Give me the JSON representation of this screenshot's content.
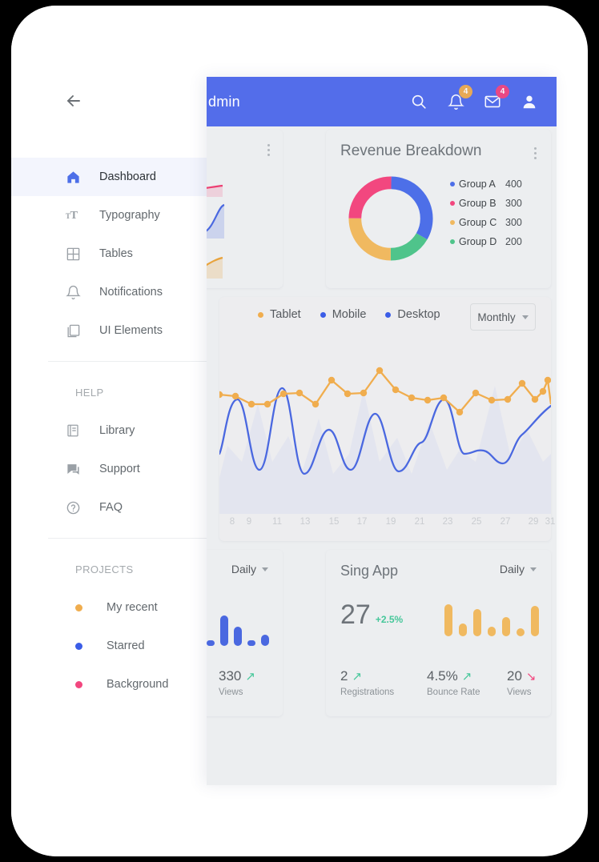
{
  "header": {
    "title": "dmin",
    "search_icon": "search-icon",
    "bell_badge": "4",
    "bell_badge_color": "#f0ad4e",
    "mail_badge": "4",
    "mail_badge_color": "#f2477f",
    "brand_color": "#536dea"
  },
  "sidebar": {
    "back_label": "back-arrow",
    "nav": [
      {
        "label": "Dashboard",
        "icon": "home-icon",
        "active": true
      },
      {
        "label": "Typography",
        "icon": "typography-icon",
        "active": false
      },
      {
        "label": "Tables",
        "icon": "table-grid-icon",
        "active": false
      },
      {
        "label": "Notifications",
        "icon": "bell-icon",
        "active": false
      },
      {
        "label": "UI Elements",
        "icon": "layers-icon",
        "active": false
      }
    ],
    "help_heading": "HELP",
    "help": [
      {
        "label": "Library",
        "icon": "book-icon"
      },
      {
        "label": "Support",
        "icon": "chat-icon"
      },
      {
        "label": "FAQ",
        "icon": "question-circle-icon"
      }
    ],
    "projects_heading": "PROJECTS",
    "projects": [
      {
        "label": "My recent",
        "color": "#f0ad4e"
      },
      {
        "label": "Starred",
        "color": "#3b5de7"
      },
      {
        "label": "Background",
        "color": "#f2477f"
      }
    ]
  },
  "revenue_card": {
    "title": "Revenue Breakdown",
    "menu_icon": "more-vertical-icon"
  },
  "main_chart_card": {
    "legend": [
      {
        "label": "Tablet",
        "color": "#f0ad4e"
      },
      {
        "label": "Mobile",
        "color": "#3b5de7"
      },
      {
        "label": "Desktop",
        "color": "#3b5de7"
      }
    ],
    "period": "Monthly",
    "period_caret": "chevron-down-icon"
  },
  "left_stat_card": {
    "period": "Daily",
    "stat_value": "330",
    "stat_trend": "up",
    "stat_label": "Views",
    "bar_color": "#4a68e0"
  },
  "sing_app_card": {
    "title": "Sing App",
    "period": "Daily",
    "big_number": "27",
    "delta": "+2.5%",
    "bar_color": "#f0b960",
    "stats": [
      {
        "value": "2",
        "trend": "up",
        "label": "Registrations"
      },
      {
        "value": "4.5%",
        "trend": "up",
        "label": "Bounce Rate"
      },
      {
        "value": "20",
        "trend": "down",
        "label": "Views"
      }
    ]
  },
  "chart_data": [
    {
      "type": "pie",
      "title": "Revenue Breakdown",
      "labels": [
        "Group A",
        "Group B",
        "Group C",
        "Group D"
      ],
      "values": [
        400,
        300,
        300,
        200
      ],
      "colors": [
        "#4d6fe8",
        "#4fc48b",
        "#f0b960",
        "#f2477f"
      ],
      "legend_colors": [
        "#4d6fe8",
        "#f2477f",
        "#f0b960",
        "#4fc48b"
      ],
      "legend": "right",
      "donut": true
    },
    {
      "type": "line",
      "title": "",
      "xlabel": "",
      "ylabel": "",
      "grid": false,
      "legend": "top-left",
      "x": [
        8,
        9,
        11,
        13,
        15,
        17,
        19,
        21,
        23,
        25,
        27,
        29,
        31
      ],
      "tick_labels": [
        "8",
        "9",
        "11",
        "13",
        "15",
        "17",
        "19",
        "21",
        "23",
        "25",
        "27",
        "29",
        "31"
      ],
      "series": [
        {
          "name": "Tablet",
          "color": "#f0ad4e",
          "markers": true,
          "values": [
            68,
            58,
            58,
            67,
            67,
            62,
            74,
            60,
            58,
            78,
            66,
            62,
            62,
            61,
            54,
            64,
            61,
            61,
            70,
            60,
            64,
            67,
            80,
            57
          ]
        },
        {
          "name": "Mobile",
          "color": "#3b5de7",
          "markers": false,
          "values": [
            38,
            50,
            25,
            54,
            24,
            42,
            30,
            34,
            47,
            28,
            50,
            32,
            22,
            40,
            52,
            38,
            30,
            44,
            56
          ]
        },
        {
          "name": "Desktop",
          "color": "#dfe2ef",
          "area": true,
          "values": [
            20,
            44,
            22,
            46,
            20,
            30,
            26,
            52,
            24,
            32,
            56,
            30,
            48,
            26
          ]
        }
      ]
    },
    {
      "type": "bar",
      "title": "Left stat sparkbars",
      "color": "#4a68e0",
      "values": [
        8,
        40,
        26,
        8,
        16
      ]
    },
    {
      "type": "bar",
      "title": "Sing App sparkbars",
      "color": "#f0b960",
      "values": [
        42,
        18,
        36,
        14,
        26,
        12,
        40
      ]
    },
    {
      "type": "area",
      "title": "Sparkline card",
      "series": [
        {
          "name": "series-pink",
          "color": "#ec3f72",
          "values": [
            34,
            18,
            12,
            46,
            52,
            30,
            18,
            20,
            22
          ]
        },
        {
          "name": "series-blue",
          "color": "#4a68e0",
          "values": [
            18,
            40,
            50,
            20,
            14,
            38,
            20,
            14,
            44
          ]
        },
        {
          "name": "series-orange",
          "color": "#e8a33d",
          "values": [
            28,
            24,
            22,
            18,
            46,
            52,
            30,
            16,
            34
          ]
        }
      ]
    }
  ]
}
